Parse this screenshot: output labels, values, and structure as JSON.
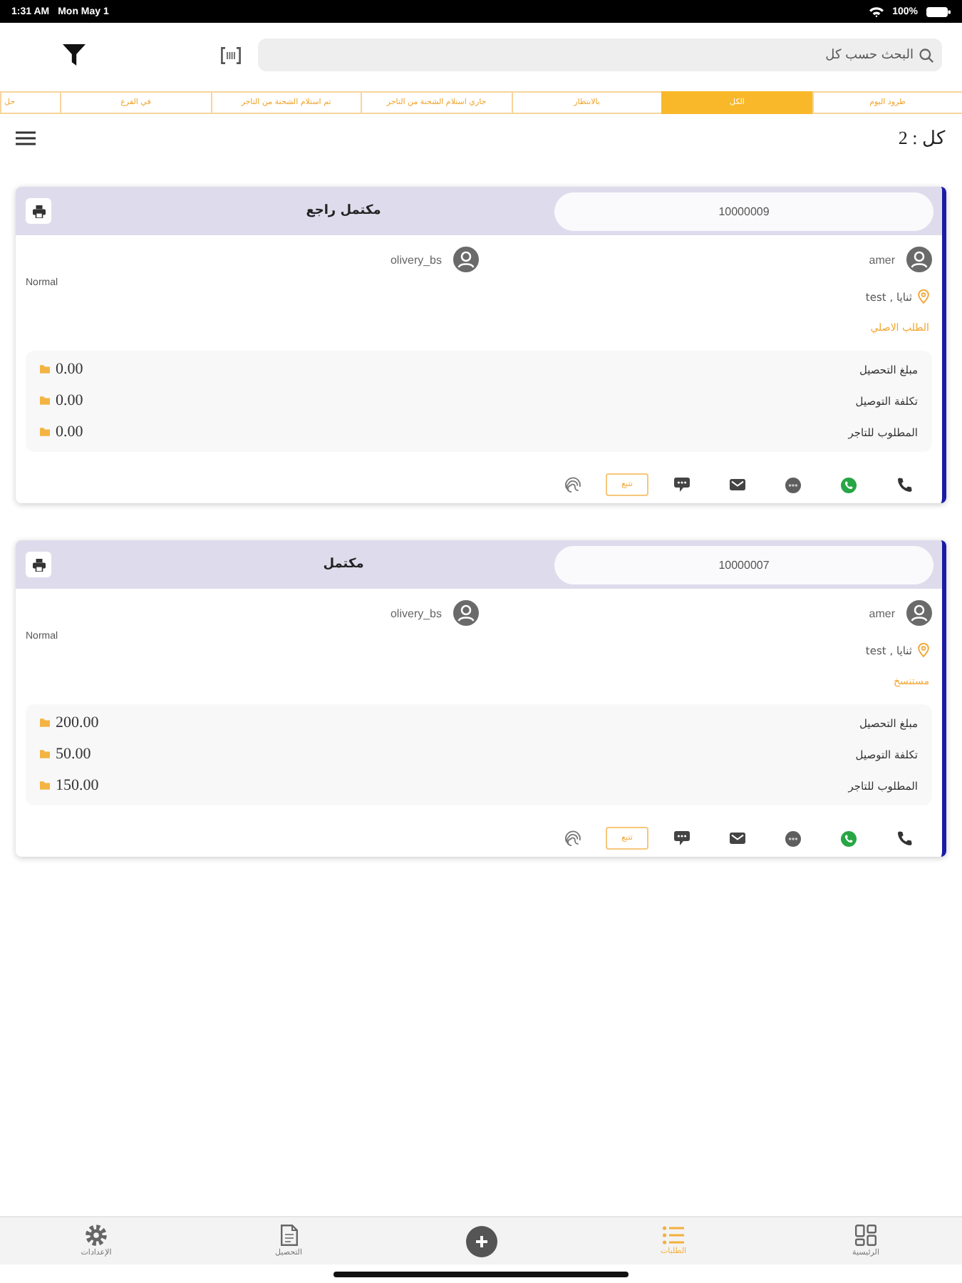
{
  "status_bar": {
    "time": "1:31 AM",
    "date": "Mon May 1",
    "battery": "100%"
  },
  "search": {
    "placeholder": "البحث حسب كل"
  },
  "tabs": [
    {
      "label": "طرود اليوم",
      "selected": false
    },
    {
      "label": "الكل",
      "selected": true
    },
    {
      "label": "بالانتظار",
      "selected": false
    },
    {
      "label": "جاري استلام الشحنة من التاجر",
      "selected": false
    },
    {
      "label": "تم استلام الشحنة من التاجر",
      "selected": false
    },
    {
      "label": "في الفرع",
      "selected": false
    },
    {
      "label": "حل",
      "selected": false
    }
  ],
  "summary": {
    "count": "كل : 2"
  },
  "orders": [
    {
      "number": "10000009",
      "status": "مكتمل راجع",
      "customer": "amer",
      "driver": "olivery_bs",
      "priority": "Normal",
      "location": "ثنايا , test",
      "related_label": "الطلب الاصلي",
      "amounts": [
        {
          "label": "مبلغ التحصيل",
          "value": "0.00"
        },
        {
          "label": "تكلفة التوصيل",
          "value": "0.00"
        },
        {
          "label": "المطلوب للتاجر",
          "value": "0.00"
        }
      ],
      "action_button": "تتبع"
    },
    {
      "number": "10000007",
      "status": "مكتمل",
      "customer": "amer",
      "driver": "olivery_bs",
      "priority": "Normal",
      "location": "ثنايا , test",
      "related_label": "مستنسخ",
      "amounts": [
        {
          "label": "مبلغ التحصيل",
          "value": "200.00"
        },
        {
          "label": "تكلفة التوصيل",
          "value": "50.00"
        },
        {
          "label": "المطلوب للتاجر",
          "value": "150.00"
        }
      ],
      "action_button": "تتبع"
    }
  ],
  "bottom_nav": [
    {
      "kind": "tab",
      "label": "الرئيسية",
      "selected": false
    },
    {
      "kind": "tab",
      "label": "الطلبات",
      "selected": true
    },
    {
      "kind": "action",
      "selected": false
    },
    {
      "kind": "tab",
      "label": "التحصيل",
      "selected": false
    },
    {
      "kind": "tab",
      "label": "الإعدادات",
      "selected": false
    }
  ]
}
